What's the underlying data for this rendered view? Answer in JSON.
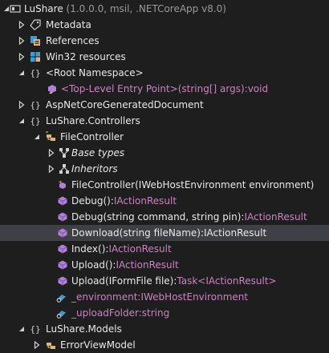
{
  "colors": {
    "background": "#1e1e1e",
    "selected_row": "#3f3f46",
    "text": "#e8e8e8",
    "type_text": "#c586c0",
    "dim_text": "#9a9a9a",
    "method_icon": "#b180d7",
    "field_icon": "#3c9ed8",
    "folder_icon": "#dcb67a"
  },
  "assembly": {
    "name": "LuShare",
    "info": "(1.0.0.0, msil, .NETCoreApp v8.0)"
  },
  "metadata": "Metadata",
  "references": "References",
  "win32_resources": "Win32 resources",
  "root_namespace": {
    "label": "<Root Namespace>",
    "entry_point": "<Top-Level Entry Point>(string[] args):void"
  },
  "generated_doc": "AspNetCoreGeneratedDocument",
  "controllers_ns": "LuShare.Controllers",
  "file_controller": {
    "label": "FileController",
    "base_types": "Base types",
    "inheritors": "Inheritors",
    "ctor": "FileController(IWebHostEnvironment environment)",
    "members": [
      {
        "name": "Debug():",
        "type": "IActionResult"
      },
      {
        "name": "Debug(string command, string pin):",
        "type": "IActionResult"
      },
      {
        "name": "Download(string fileName):",
        "type": "IActionResult"
      },
      {
        "name": "Index():",
        "type": "IActionResult"
      },
      {
        "name": "Upload():",
        "type": "IActionResult"
      },
      {
        "name": "Upload(IFormFile file):",
        "type": "Task<IActionResult>"
      }
    ],
    "fields": [
      "_environment:IWebHostEnvironment",
      "_uploadFolder:string"
    ]
  },
  "models_ns": "LuShare.Models",
  "error_view_model": "ErrorViewModel"
}
